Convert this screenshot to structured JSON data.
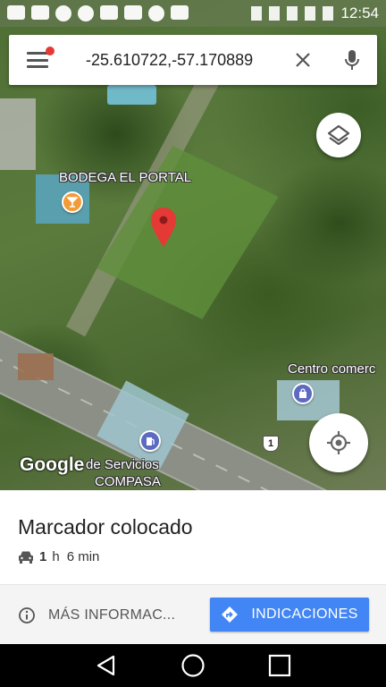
{
  "status_bar": {
    "time": "12:54"
  },
  "search": {
    "query": "-25.610722,-57.170889"
  },
  "map": {
    "labels": {
      "bodega": "BODEGA EL PORTAL",
      "centro": "Centro comerc",
      "servicios_line1": "de Servicios",
      "servicios_line2": "COMPASA",
      "route_number": "1",
      "logo": "Google"
    }
  },
  "place": {
    "title": "Marcador colocado",
    "eta": {
      "hours": "1",
      "hours_unit": "h",
      "duration": "6 min"
    }
  },
  "actions": {
    "more_info": "MÁS INFORMAC...",
    "directions": "INDICACIONES"
  },
  "colors": {
    "accent_blue": "#4285f4",
    "marker_red": "#e53935"
  }
}
